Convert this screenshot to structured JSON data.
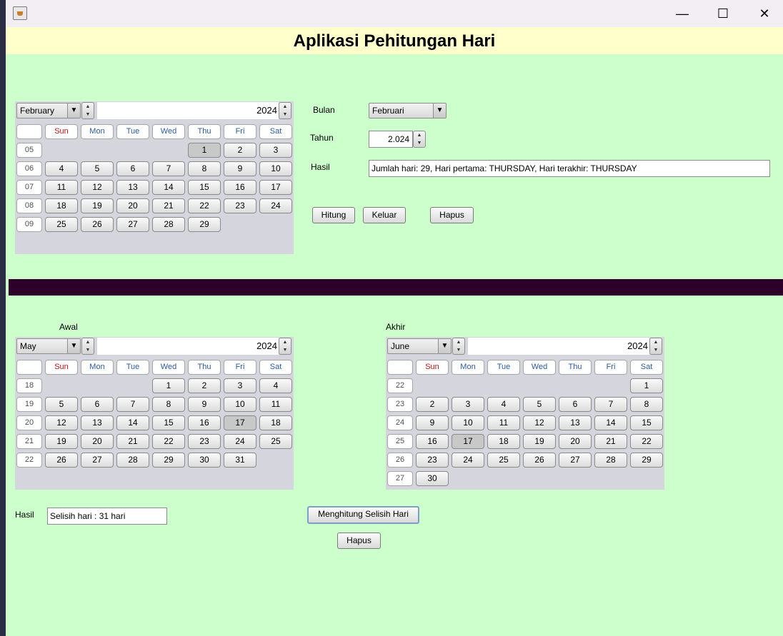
{
  "window": {
    "title": "",
    "minimize_glyph": "—",
    "maximize_glyph": "☐",
    "close_glyph": "✕"
  },
  "banner": {
    "title": "Aplikasi Pehitungan Hari"
  },
  "weekday_headers": [
    "Sun",
    "Mon",
    "Tue",
    "Wed",
    "Thu",
    "Fri",
    "Sat"
  ],
  "calendars": [
    {
      "id": "top",
      "month": "February",
      "year": "2024",
      "first_weekday": 4,
      "days": 29,
      "selected": 1,
      "week_numbers": [
        "05",
        "06",
        "07",
        "08",
        "09"
      ]
    },
    {
      "id": "awal",
      "label": "Awal",
      "month": "May",
      "year": "2024",
      "first_weekday": 3,
      "days": 31,
      "selected": 17,
      "week_numbers": [
        "18",
        "19",
        "20",
        "21",
        "22"
      ]
    },
    {
      "id": "akhir",
      "label": "Akhir",
      "month": "June",
      "year": "2024",
      "first_weekday": 6,
      "days": 30,
      "selected": 17,
      "week_numbers": [
        "22",
        "23",
        "24",
        "25",
        "26",
        "27"
      ]
    }
  ],
  "form": {
    "bulan_label": "Bulan",
    "bulan_value": "Februari",
    "tahun_label": "Tahun",
    "tahun_value": "2.024",
    "hasil_label": "Hasil",
    "hasil_value": "Jumlah hari: 29, Hari pertama: THURSDAY, Hari terakhir: THURSDAY",
    "hitung_button": "Hitung",
    "keluar_button": "Keluar",
    "hapus_button": "Hapus"
  },
  "selisih": {
    "hasil_label": "Hasil",
    "hasil_value": "Selisih hari : 31 hari",
    "hitung_button": "Menghitung Selisih Hari",
    "hapus_button": "Hapus"
  },
  "colors": {
    "background": "#ccffcc",
    "banner": "#ffffcc",
    "divider": "#2d0029",
    "calendar_panel": "#d5d5de"
  }
}
